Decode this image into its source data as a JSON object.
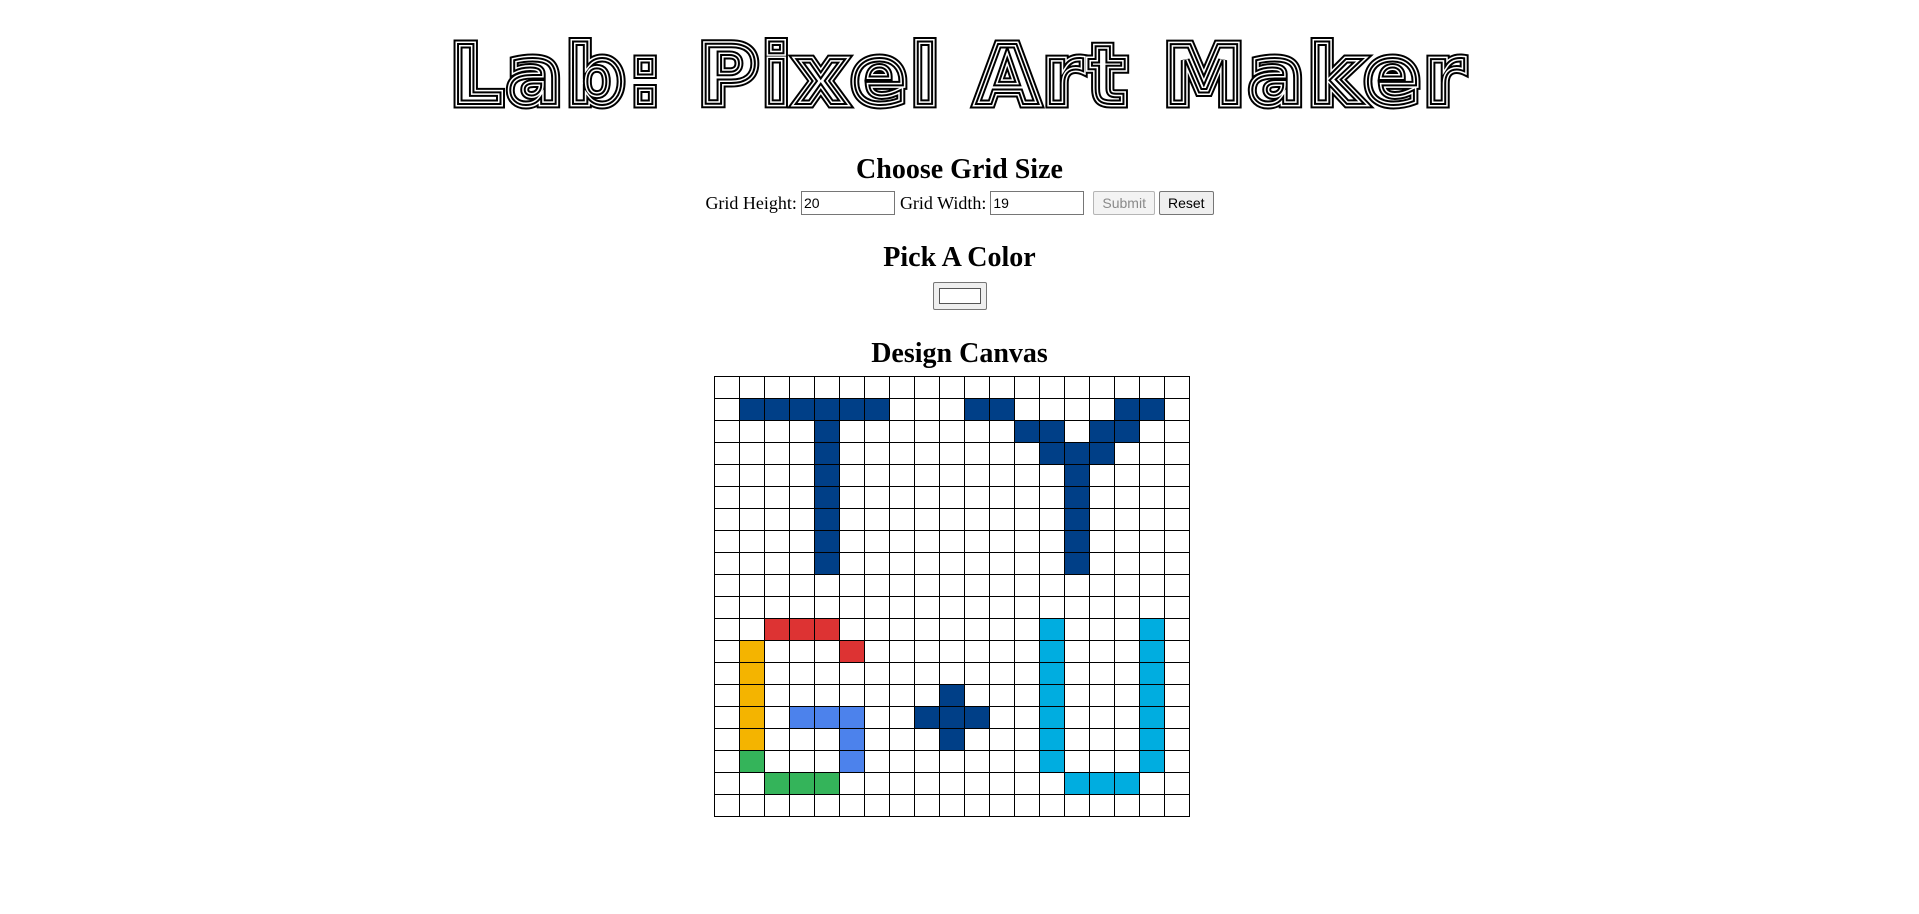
{
  "title": "Lab: Pixel Art Maker",
  "grid_form": {
    "heading": "Choose Grid Size",
    "height_label": "Grid Height:",
    "height_value": "20",
    "width_label": "Grid Width:",
    "width_value": "19",
    "submit_label": "Submit",
    "reset_label": "Reset"
  },
  "color_section": {
    "heading": "Pick A Color",
    "selected_color": "#ffffff"
  },
  "canvas_section": {
    "heading": "Design Canvas",
    "rows": 20,
    "cols": 19,
    "palette": {
      "navy": "#003F87",
      "red": "#DD3333",
      "yellow": "#F4B400",
      "blue": "#4C82EC",
      "green": "#34B45A",
      "cyan": "#00ADE0"
    },
    "cells": [
      {
        "row": 1,
        "cols": [
          1,
          2,
          3,
          4,
          5,
          6,
          10,
          11,
          16,
          17
        ],
        "color": "navy"
      },
      {
        "row": 2,
        "cols": [
          4,
          12,
          13,
          15,
          16
        ],
        "color": "navy"
      },
      {
        "row": 3,
        "cols": [
          4,
          13,
          14,
          15
        ],
        "color": "navy"
      },
      {
        "row": 4,
        "cols": [
          4,
          14
        ],
        "color": "navy"
      },
      {
        "row": 5,
        "cols": [
          4,
          14
        ],
        "color": "navy"
      },
      {
        "row": 6,
        "cols": [
          4,
          14
        ],
        "color": "navy"
      },
      {
        "row": 7,
        "cols": [
          4,
          14
        ],
        "color": "navy"
      },
      {
        "row": 8,
        "cols": [
          4,
          14
        ],
        "color": "navy"
      },
      {
        "row": 11,
        "cols": [
          2,
          3,
          4
        ],
        "color": "red"
      },
      {
        "row": 11,
        "cols": [
          13,
          17
        ],
        "color": "cyan"
      },
      {
        "row": 12,
        "cols": [
          5
        ],
        "color": "red"
      },
      {
        "row": 12,
        "cols": [
          1
        ],
        "color": "yellow"
      },
      {
        "row": 12,
        "cols": [
          13,
          17
        ],
        "color": "cyan"
      },
      {
        "row": 13,
        "cols": [
          1
        ],
        "color": "yellow"
      },
      {
        "row": 13,
        "cols": [
          13,
          17
        ],
        "color": "cyan"
      },
      {
        "row": 14,
        "cols": [
          1
        ],
        "color": "yellow"
      },
      {
        "row": 14,
        "cols": [
          9
        ],
        "color": "navy"
      },
      {
        "row": 14,
        "cols": [
          13,
          17
        ],
        "color": "cyan"
      },
      {
        "row": 15,
        "cols": [
          1
        ],
        "color": "yellow"
      },
      {
        "row": 15,
        "cols": [
          3,
          4,
          5
        ],
        "color": "blue"
      },
      {
        "row": 15,
        "cols": [
          8,
          9,
          10
        ],
        "color": "navy"
      },
      {
        "row": 15,
        "cols": [
          13,
          17
        ],
        "color": "cyan"
      },
      {
        "row": 16,
        "cols": [
          1
        ],
        "color": "yellow"
      },
      {
        "row": 16,
        "cols": [
          5
        ],
        "color": "blue"
      },
      {
        "row": 16,
        "cols": [
          9
        ],
        "color": "navy"
      },
      {
        "row": 16,
        "cols": [
          13,
          17
        ],
        "color": "cyan"
      },
      {
        "row": 17,
        "cols": [
          1
        ],
        "color": "green"
      },
      {
        "row": 17,
        "cols": [
          5
        ],
        "color": "blue"
      },
      {
        "row": 17,
        "cols": [
          13,
          17
        ],
        "color": "cyan"
      },
      {
        "row": 18,
        "cols": [
          2,
          3,
          4
        ],
        "color": "green"
      },
      {
        "row": 18,
        "cols": [
          14,
          15,
          16
        ],
        "color": "cyan"
      }
    ]
  }
}
